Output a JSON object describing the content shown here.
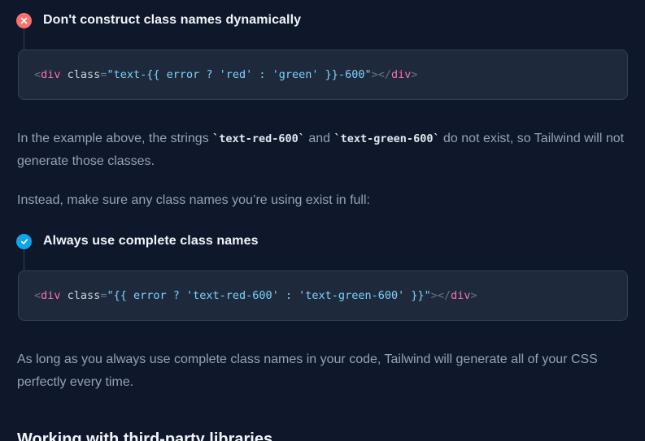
{
  "colors": {
    "background": "#0f172a",
    "code_background": "#1e293b",
    "error_badge": "#f87171",
    "success_badge": "#0ea5e9"
  },
  "bad_example": {
    "icon": "x-icon",
    "heading": "Don't construct class names dynamically",
    "code": {
      "open_lt": "<",
      "tag": "div",
      "attr": " class",
      "eq": "=",
      "quote_open": "\"",
      "value": "text-{{ error ? 'red' : 'green' }}-600",
      "quote_close": "\"",
      "open_gt": ">",
      "close_lt": "</",
      "close_tag": "div",
      "close_gt": ">"
    }
  },
  "explanation": {
    "text_before": "In the example above, the strings ",
    "code1": "`text-red-600`",
    "text_middle": " and ",
    "code2": "`text-green-600`",
    "text_after": " do not exist, so Tailwind will not generate those classes."
  },
  "instead_text": "Instead, make sure any class names you’re using exist in full:",
  "good_example": {
    "icon": "check-icon",
    "heading": "Always use complete class names",
    "code": {
      "open_lt": "<",
      "tag": "div",
      "attr": " class",
      "eq": "=",
      "quote_open": "\"",
      "value": "{{ error ? 'text-red-600' : 'text-green-600' }}",
      "quote_close": "\"",
      "open_gt": ">",
      "close_lt": "</",
      "close_tag": "div",
      "close_gt": ">"
    }
  },
  "closing_text": "As long as you always use complete class names in your code, Tailwind will generate all of your CSS perfectly every time.",
  "next_section_title": "Working with third-party libraries"
}
